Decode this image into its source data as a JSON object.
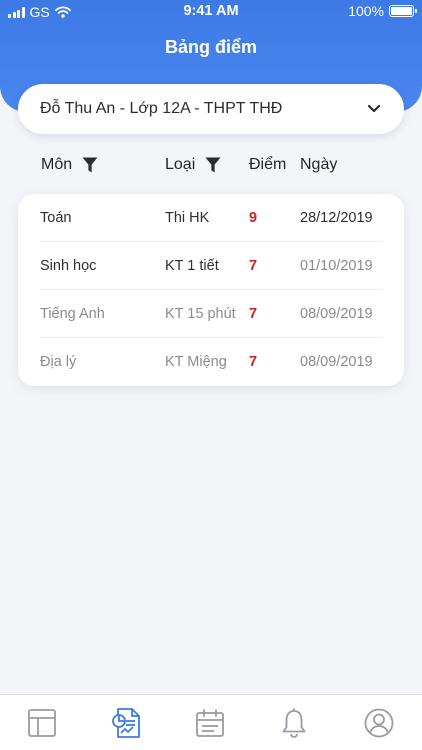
{
  "status_bar": {
    "carrier": "GS",
    "time": "9:41 AM",
    "battery": "100%"
  },
  "header": {
    "title": "Bảng điểm"
  },
  "selector": {
    "label": "Đỗ Thu An - Lớp 12A - THPT THĐ"
  },
  "columns": {
    "subject": "Môn",
    "type": "Loại",
    "score": "Điểm",
    "date": "Ngày"
  },
  "grades": [
    {
      "subject": "Toán",
      "type": "Thi HK",
      "score": "9",
      "date": "28/12/2019"
    },
    {
      "subject": "Sinh học",
      "type": "KT 1 tiết",
      "score": "7",
      "date": "01/10/2019"
    },
    {
      "subject": "Tiếng Anh",
      "type": "KT 15 phút",
      "score": "7",
      "date": "08/09/2019"
    },
    {
      "subject": "Địa lý",
      "type": "KT Miệng",
      "score": "7",
      "date": "08/09/2019"
    }
  ],
  "colors": {
    "accent": "#4a86ee",
    "score": "#d0202a",
    "tab_active": "#3d7ae6",
    "tab_inactive": "#9a9aa3"
  },
  "tabs": [
    {
      "icon": "dashboard-icon",
      "active": false
    },
    {
      "icon": "report-chart-icon",
      "active": true
    },
    {
      "icon": "calendar-icon",
      "active": false
    },
    {
      "icon": "bell-icon",
      "active": false
    },
    {
      "icon": "profile-icon",
      "active": false
    }
  ]
}
